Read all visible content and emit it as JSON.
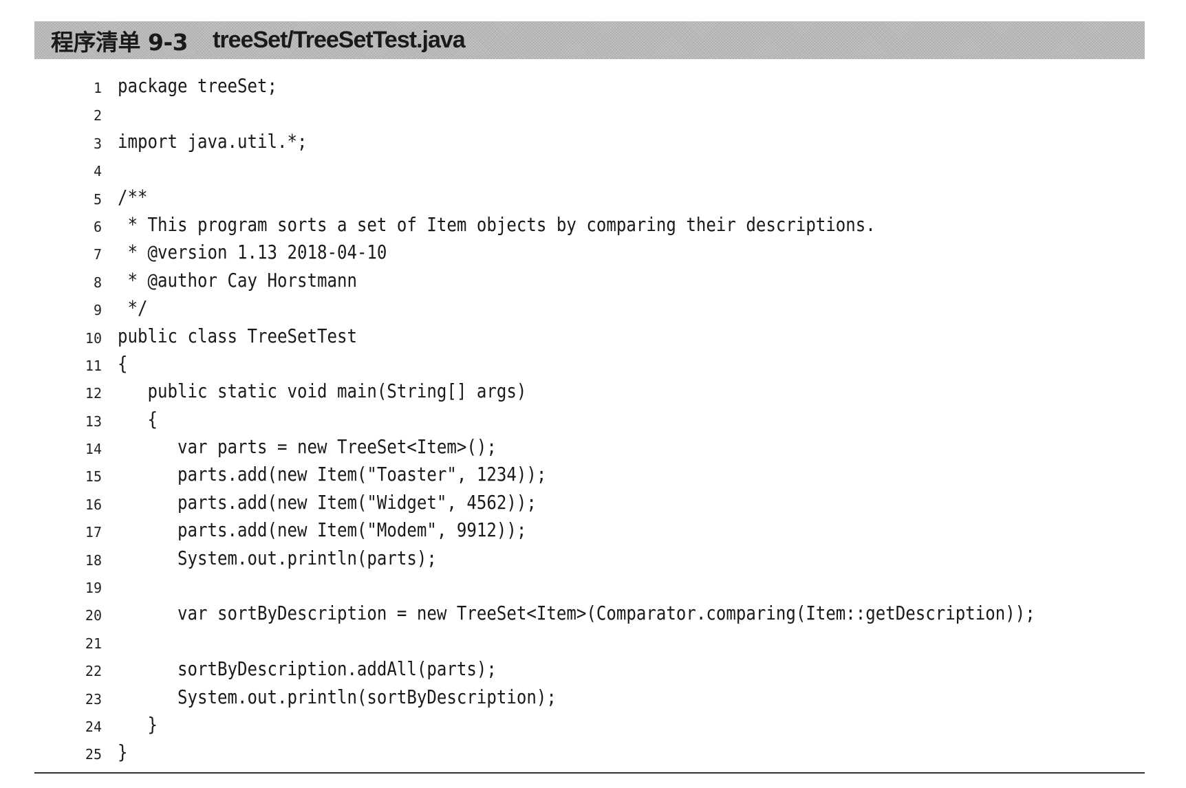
{
  "listing": {
    "label": "程序清单 9-3",
    "filename": "treeSet/TreeSetTest.java"
  },
  "code": {
    "lines": [
      {
        "number": "1",
        "text": "package treeSet;"
      },
      {
        "number": "2",
        "text": ""
      },
      {
        "number": "3",
        "text": "import java.util.*;"
      },
      {
        "number": "4",
        "text": ""
      },
      {
        "number": "5",
        "text": "/**"
      },
      {
        "number": "6",
        "text": " * This program sorts a set of Item objects by comparing their descriptions."
      },
      {
        "number": "7",
        "text": " * @version 1.13 2018-04-10"
      },
      {
        "number": "8",
        "text": " * @author Cay Horstmann"
      },
      {
        "number": "9",
        "text": " */"
      },
      {
        "number": "10",
        "text": "public class TreeSetTest"
      },
      {
        "number": "11",
        "text": "{"
      },
      {
        "number": "12",
        "text": "   public static void main(String[] args)"
      },
      {
        "number": "13",
        "text": "   {"
      },
      {
        "number": "14",
        "text": "      var parts = new TreeSet<Item>();"
      },
      {
        "number": "15",
        "text": "      parts.add(new Item(\"Toaster\", 1234));"
      },
      {
        "number": "16",
        "text": "      parts.add(new Item(\"Widget\", 4562));"
      },
      {
        "number": "17",
        "text": "      parts.add(new Item(\"Modem\", 9912));"
      },
      {
        "number": "18",
        "text": "      System.out.println(parts);"
      },
      {
        "number": "19",
        "text": ""
      },
      {
        "number": "20",
        "text": "      var sortByDescription = new TreeSet<Item>(Comparator.comparing(Item::getDescription));"
      },
      {
        "number": "21",
        "text": ""
      },
      {
        "number": "22",
        "text": "      sortByDescription.addAll(parts);"
      },
      {
        "number": "23",
        "text": "      System.out.println(sortByDescription);"
      },
      {
        "number": "24",
        "text": "   }"
      },
      {
        "number": "25",
        "text": "}"
      }
    ]
  }
}
